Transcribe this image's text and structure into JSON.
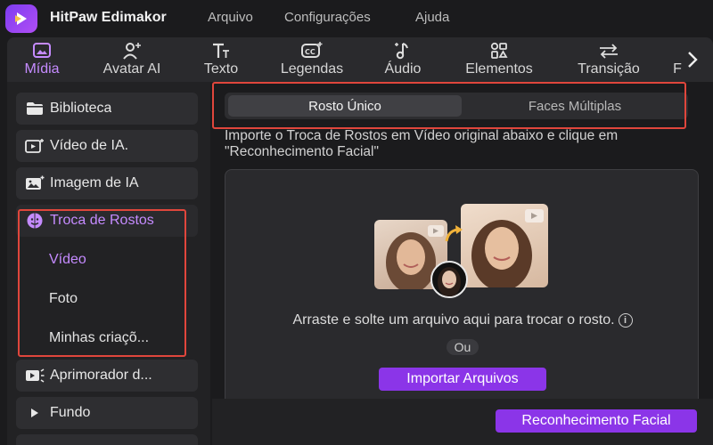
{
  "app": {
    "name": "HitPaw Edimakor",
    "menus": [
      "Arquivo",
      "Configurações",
      "Ajuda"
    ]
  },
  "toolbar": {
    "items": [
      {
        "label": "Mídia",
        "icon": "media-icon",
        "active": true
      },
      {
        "label": "Avatar AI",
        "icon": "avatar-icon",
        "active": false
      },
      {
        "label": "Texto",
        "icon": "text-icon",
        "active": false
      },
      {
        "label": "Legendas",
        "icon": "captions-icon",
        "active": false
      },
      {
        "label": "Áudio",
        "icon": "audio-icon",
        "active": false
      },
      {
        "label": "Elementos",
        "icon": "elements-icon",
        "active": false
      },
      {
        "label": "Transição",
        "icon": "transition-icon",
        "active": false
      },
      {
        "label": "F",
        "icon": "",
        "active": false
      }
    ]
  },
  "sidebar": {
    "items": [
      {
        "label": "Biblioteca",
        "icon": "folder-icon"
      },
      {
        "label": "Vídeo de IA.",
        "icon": "ai-video-icon"
      },
      {
        "label": "Imagem de IA",
        "icon": "ai-image-icon"
      },
      {
        "label": "Troca de Rostos",
        "icon": "face-swap-icon"
      },
      {
        "label": "Aprimorador d...",
        "icon": "enhancer-icon"
      },
      {
        "label": "Fundo",
        "icon": "play-triangle-icon"
      }
    ],
    "subitems": [
      "Vídeo",
      "Foto",
      "Minhas criaçõ..."
    ]
  },
  "main": {
    "tabs": [
      {
        "label": "Rosto Único",
        "active": true
      },
      {
        "label": "Faces Múltiplas",
        "active": false
      }
    ],
    "hint": "Importe o Troca de Rostos em Vídeo original abaixo e clique em \"Reconhecimento Facial\"",
    "drop_text": "Arraste e solte um arquivo aqui para trocar o rosto.",
    "or_text": "Ou",
    "import_label": "Importar Arquivos",
    "recognize_label": "Reconhecimento Facial"
  },
  "colors": {
    "accent": "#8b35e8",
    "active_text": "#c58bff",
    "highlight_box": "#e0463c"
  }
}
